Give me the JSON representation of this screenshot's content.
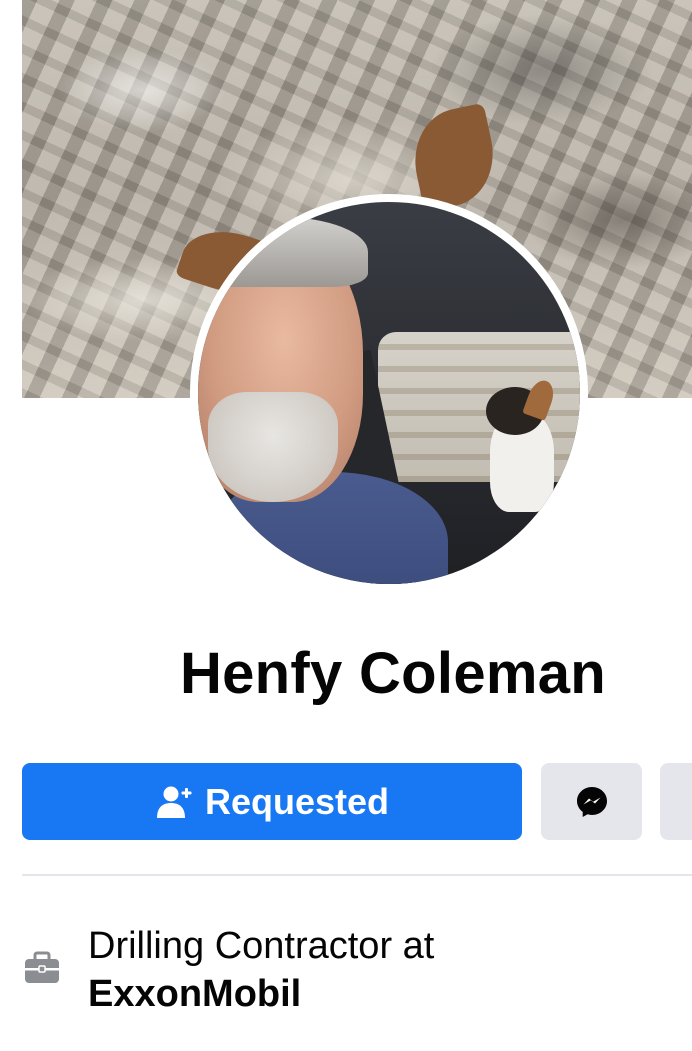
{
  "profile": {
    "name": "Henfy Coleman"
  },
  "actions": {
    "primary_label": "Requested",
    "primary_icon": "person-requested-icon",
    "message_icon": "messenger-icon"
  },
  "work": {
    "icon": "briefcase-icon",
    "line1": "Drilling Contractor at",
    "employer": "ExxonMobil"
  },
  "colors": {
    "accent": "#1877f2",
    "secondary_button": "#e4e6eb",
    "text": "#050505"
  }
}
